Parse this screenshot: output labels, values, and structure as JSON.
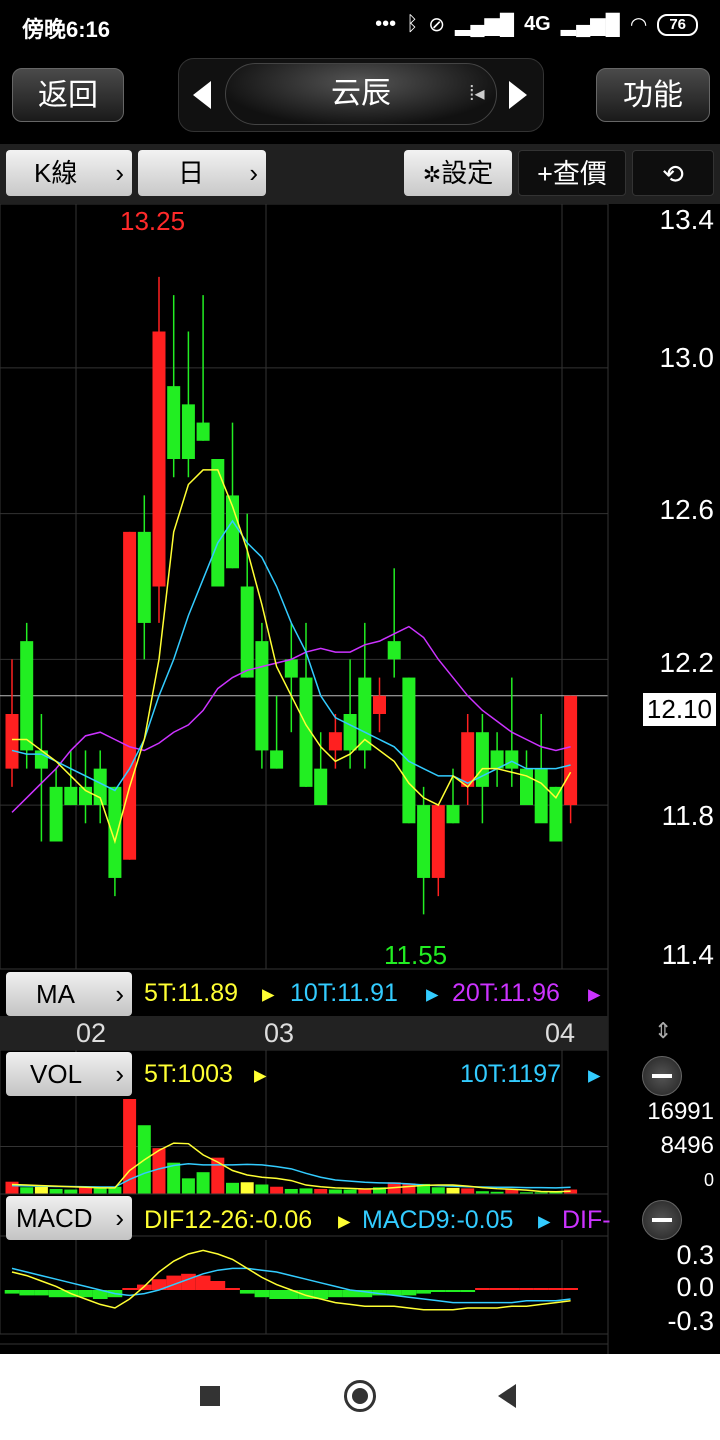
{
  "status_bar": {
    "time": "傍晚6:16",
    "network": "4G",
    "battery": "76",
    "icons": [
      "more-icon",
      "bluetooth-icon",
      "alarm-off-icon",
      "signal-icon",
      "wifi-icon",
      "battery-icon"
    ]
  },
  "header": {
    "back_label": "返回",
    "stock_name": "云辰",
    "function_label": "功能"
  },
  "toolbar": {
    "chart_type": "K線",
    "period": "日",
    "settings_label": "設定",
    "query_label": "+查價"
  },
  "price_axis": {
    "labels": [
      "13.4",
      "13.0",
      "12.6",
      "12.2",
      "11.8",
      "11.4"
    ],
    "current_price": "12.10",
    "high_label": "13.25",
    "low_label": "11.55"
  },
  "date_axis": {
    "labels": [
      "02",
      "03",
      "04"
    ]
  },
  "ma_indicator": {
    "label": "MA",
    "ma5": "5T:11.89",
    "ma10": "10T:11.91",
    "ma20": "20T:11.96",
    "colors": {
      "ma5": "#ffff33",
      "ma10": "#33ccff",
      "ma20": "#cc33ff"
    }
  },
  "vol_indicator": {
    "label": "VOL",
    "vol5": "5T:1003",
    "vol10": "10T:1197",
    "axis": [
      "16991",
      "8496",
      "0"
    ]
  },
  "macd_indicator": {
    "label": "MACD",
    "dif": "DIF12-26:-0.06",
    "macd9": "MACD9:-0.05",
    "diff": "DIF-",
    "axis": [
      "0.3",
      "0.0",
      "-0.3"
    ]
  },
  "chart_data": {
    "type": "candlestick",
    "up_color": "#ff2020",
    "down_color": "#22ee22",
    "ylim": [
      11.35,
      13.45
    ],
    "candles": [
      {
        "o": 11.9,
        "h": 12.2,
        "l": 11.85,
        "c": 12.05
      },
      {
        "o": 12.25,
        "h": 12.3,
        "l": 11.9,
        "c": 11.95
      },
      {
        "o": 11.95,
        "h": 12.05,
        "l": 11.7,
        "c": 11.9
      },
      {
        "o": 11.85,
        "h": 11.9,
        "l": 11.7,
        "c": 11.7
      },
      {
        "o": 11.85,
        "h": 11.95,
        "l": 11.8,
        "c": 11.8
      },
      {
        "o": 11.85,
        "h": 11.95,
        "l": 11.75,
        "c": 11.8
      },
      {
        "o": 11.9,
        "h": 11.95,
        "l": 11.75,
        "c": 11.8
      },
      {
        "o": 11.85,
        "h": 11.85,
        "l": 11.55,
        "c": 11.6
      },
      {
        "o": 11.65,
        "h": 12.55,
        "l": 11.65,
        "c": 12.55
      },
      {
        "o": 12.55,
        "h": 12.65,
        "l": 12.2,
        "c": 12.3
      },
      {
        "o": 12.4,
        "h": 13.25,
        "l": 12.3,
        "c": 13.1
      },
      {
        "o": 12.95,
        "h": 13.2,
        "l": 12.7,
        "c": 12.75
      },
      {
        "o": 12.9,
        "h": 13.1,
        "l": 12.7,
        "c": 12.75
      },
      {
        "o": 12.85,
        "h": 13.2,
        "l": 12.8,
        "c": 12.8
      },
      {
        "o": 12.75,
        "h": 12.75,
        "l": 12.4,
        "c": 12.4
      },
      {
        "o": 12.65,
        "h": 12.85,
        "l": 12.45,
        "c": 12.45
      },
      {
        "o": 12.4,
        "h": 12.6,
        "l": 12.15,
        "c": 12.15
      },
      {
        "o": 12.25,
        "h": 12.3,
        "l": 11.9,
        "c": 11.95
      },
      {
        "o": 11.95,
        "h": 12.1,
        "l": 11.9,
        "c": 11.9
      },
      {
        "o": 12.2,
        "h": 12.3,
        "l": 12.0,
        "c": 12.15
      },
      {
        "o": 12.15,
        "h": 12.3,
        "l": 11.85,
        "c": 11.85
      },
      {
        "o": 11.9,
        "h": 12.0,
        "l": 11.8,
        "c": 11.8
      },
      {
        "o": 11.95,
        "h": 12.05,
        "l": 11.9,
        "c": 12.0
      },
      {
        "o": 12.05,
        "h": 12.2,
        "l": 11.9,
        "c": 11.95
      },
      {
        "o": 12.15,
        "h": 12.3,
        "l": 11.9,
        "c": 11.95
      },
      {
        "o": 12.05,
        "h": 12.15,
        "l": 12.0,
        "c": 12.1
      },
      {
        "o": 12.25,
        "h": 12.45,
        "l": 12.15,
        "c": 12.2
      },
      {
        "o": 12.15,
        "h": 12.15,
        "l": 11.75,
        "c": 11.75
      },
      {
        "o": 11.8,
        "h": 11.85,
        "l": 11.5,
        "c": 11.6
      },
      {
        "o": 11.6,
        "h": 11.8,
        "l": 11.55,
        "c": 11.8
      },
      {
        "o": 11.8,
        "h": 11.9,
        "l": 11.75,
        "c": 11.75
      },
      {
        "o": 11.85,
        "h": 12.05,
        "l": 11.8,
        "c": 12.0
      },
      {
        "o": 12.0,
        "h": 12.05,
        "l": 11.75,
        "c": 11.85
      },
      {
        "o": 11.95,
        "h": 12.0,
        "l": 11.85,
        "c": 11.9
      },
      {
        "o": 11.95,
        "h": 12.15,
        "l": 11.85,
        "c": 11.9
      },
      {
        "o": 11.9,
        "h": 11.95,
        "l": 11.85,
        "c": 11.8
      },
      {
        "o": 11.9,
        "h": 12.05,
        "l": 11.8,
        "c": 11.75
      },
      {
        "o": 11.85,
        "h": 11.85,
        "l": 11.7,
        "c": 11.7
      },
      {
        "o": 11.8,
        "h": 12.1,
        "l": 11.75,
        "c": 12.1
      }
    ],
    "ma5": [
      11.98,
      11.98,
      11.95,
      11.92,
      11.88,
      11.84,
      11.82,
      11.7,
      11.85,
      11.98,
      12.2,
      12.55,
      12.68,
      12.72,
      12.72,
      12.62,
      12.5,
      12.35,
      12.18,
      12.1,
      12.02,
      11.96,
      11.92,
      11.94,
      11.98,
      11.95,
      11.92,
      11.86,
      11.82,
      11.8,
      11.88,
      11.85,
      11.9,
      11.9,
      11.89,
      11.88,
      11.86,
      11.82,
      11.89
    ],
    "ma10": [
      11.95,
      11.94,
      11.94,
      11.92,
      11.9,
      11.88,
      11.86,
      11.84,
      11.9,
      11.98,
      12.1,
      12.2,
      12.32,
      12.42,
      12.52,
      12.58,
      12.52,
      12.48,
      12.4,
      12.3,
      12.22,
      12.1,
      12.04,
      12.02,
      12.0,
      11.98,
      11.96,
      11.92,
      11.9,
      11.88,
      11.88,
      11.86,
      11.88,
      11.9,
      11.92,
      11.9,
      11.9,
      11.9,
      11.91
    ],
    "ma20": [
      11.78,
      11.82,
      11.86,
      11.9,
      11.95,
      11.99,
      12.0,
      11.98,
      11.96,
      11.95,
      11.97,
      12.0,
      12.02,
      12.06,
      12.12,
      12.15,
      12.17,
      12.18,
      12.19,
      12.2,
      12.22,
      12.23,
      12.22,
      12.22,
      12.24,
      12.25,
      12.27,
      12.29,
      12.26,
      12.2,
      12.15,
      12.1,
      12.06,
      12.03,
      12.0,
      11.98,
      11.96,
      11.95,
      11.96
    ],
    "volume": [
      {
        "v": 2200,
        "c": "#ff2020"
      },
      {
        "v": 1200,
        "c": "#22ee22"
      },
      {
        "v": 1300,
        "c": "#ffff33"
      },
      {
        "v": 900,
        "c": "#22ee22"
      },
      {
        "v": 800,
        "c": "#22ee22"
      },
      {
        "v": 1200,
        "c": "#ff2020"
      },
      {
        "v": 1100,
        "c": "#22ee22"
      },
      {
        "v": 1300,
        "c": "#22ee22"
      },
      {
        "v": 16991,
        "c": "#ff2020"
      },
      {
        "v": 12300,
        "c": "#22ee22"
      },
      {
        "v": 8200,
        "c": "#ff2020"
      },
      {
        "v": 5600,
        "c": "#22ee22"
      },
      {
        "v": 2800,
        "c": "#22ee22"
      },
      {
        "v": 3900,
        "c": "#22ee22"
      },
      {
        "v": 6500,
        "c": "#ff2020"
      },
      {
        "v": 2000,
        "c": "#22ee22"
      },
      {
        "v": 2100,
        "c": "#ffff33"
      },
      {
        "v": 1700,
        "c": "#22ee22"
      },
      {
        "v": 1300,
        "c": "#ff2020"
      },
      {
        "v": 900,
        "c": "#22ee22"
      },
      {
        "v": 1000,
        "c": "#22ee22"
      },
      {
        "v": 900,
        "c": "#ff2020"
      },
      {
        "v": 800,
        "c": "#22ee22"
      },
      {
        "v": 800,
        "c": "#22ee22"
      },
      {
        "v": 800,
        "c": "#ff2020"
      },
      {
        "v": 1200,
        "c": "#22ee22"
      },
      {
        "v": 2100,
        "c": "#ff2020"
      },
      {
        "v": 1900,
        "c": "#ff2020"
      },
      {
        "v": 1800,
        "c": "#22ee22"
      },
      {
        "v": 1200,
        "c": "#22ee22"
      },
      {
        "v": 1100,
        "c": "#ffff33"
      },
      {
        "v": 1000,
        "c": "#ff2020"
      },
      {
        "v": 500,
        "c": "#22ee22"
      },
      {
        "v": 400,
        "c": "#22ee22"
      },
      {
        "v": 800,
        "c": "#ff2020"
      },
      {
        "v": 300,
        "c": "#22ee22"
      },
      {
        "v": 300,
        "c": "#22ee22"
      },
      {
        "v": 500,
        "c": "#22ee22"
      },
      {
        "v": 800,
        "c": "#ff2020"
      }
    ],
    "vol_ma5": [
      1700,
      1600,
      1500,
      1400,
      1300,
      1200,
      1100,
      1100,
      4200,
      6100,
      7800,
      9100,
      9000,
      7000,
      5700,
      4200,
      3400,
      3000,
      2800,
      2400,
      1600,
      1300,
      1100,
      1000,
      900,
      950,
      1150,
      1350,
      1550,
      1600,
      1600,
      1400,
      1150,
      950,
      850,
      700,
      450,
      400,
      500
    ],
    "vol_ma10": [
      1500,
      1450,
      1400,
      1350,
      1350,
      1300,
      1250,
      1250,
      2600,
      3700,
      4500,
      5100,
      5400,
      5200,
      5200,
      5200,
      5300,
      5200,
      4900,
      4500,
      3700,
      3000,
      2500,
      2300,
      2100,
      2000,
      1950,
      1800,
      1600,
      1500,
      1400,
      1300,
      1250,
      1200,
      1200,
      1150,
      1150,
      1100,
      1197
    ],
    "macd_hist": [
      -0.02,
      -0.03,
      -0.03,
      -0.04,
      -0.04,
      -0.04,
      -0.05,
      -0.04,
      0.01,
      0.03,
      0.06,
      0.08,
      0.09,
      0.08,
      0.05,
      0.0,
      -0.02,
      -0.04,
      -0.05,
      -0.05,
      -0.05,
      -0.05,
      -0.04,
      -0.04,
      -0.04,
      -0.03,
      -0.03,
      -0.03,
      -0.02,
      -0.01,
      -0.01,
      -0.01,
      0.0,
      0.0,
      0.0,
      0.0,
      0.0,
      0.0,
      0.0
    ],
    "dif": [
      0.1,
      0.08,
      0.05,
      0.02,
      -0.02,
      -0.05,
      -0.08,
      -0.1,
      -0.05,
      0.02,
      0.1,
      0.16,
      0.2,
      0.22,
      0.2,
      0.17,
      0.12,
      0.07,
      0.03,
      0.0,
      -0.03,
      -0.05,
      -0.07,
      -0.08,
      -0.09,
      -0.09,
      -0.09,
      -0.1,
      -0.11,
      -0.11,
      -0.11,
      -0.1,
      -0.1,
      -0.1,
      -0.09,
      -0.09,
      -0.08,
      -0.07,
      -0.06
    ],
    "dea": [
      0.12,
      0.1,
      0.08,
      0.06,
      0.04,
      0.02,
      0.0,
      -0.02,
      -0.03,
      -0.02,
      0.0,
      0.03,
      0.06,
      0.09,
      0.11,
      0.12,
      0.12,
      0.11,
      0.1,
      0.08,
      0.06,
      0.04,
      0.02,
      0.0,
      -0.01,
      -0.02,
      -0.03,
      -0.04,
      -0.05,
      -0.06,
      -0.07,
      -0.07,
      -0.07,
      -0.07,
      -0.07,
      -0.06,
      -0.06,
      -0.06,
      -0.05
    ]
  },
  "nav_bar": {
    "icons": [
      "recent-apps-icon",
      "home-icon",
      "back-icon"
    ]
  }
}
